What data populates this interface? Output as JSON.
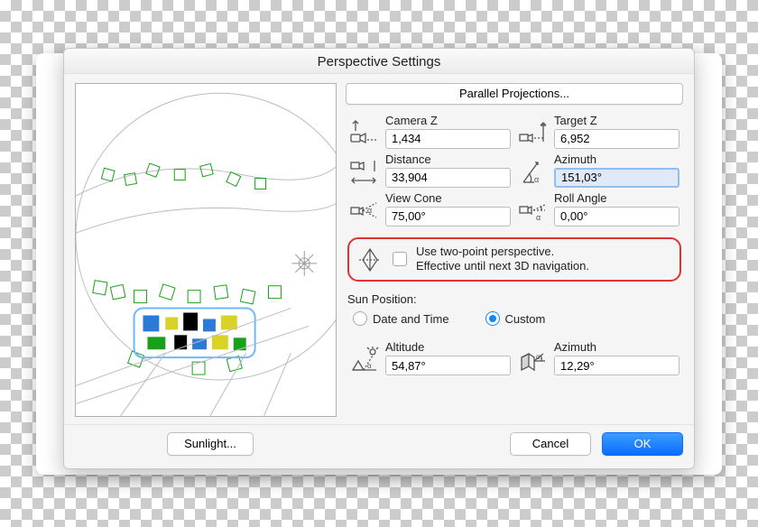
{
  "title": "Perspective Settings",
  "parallel_button": "Parallel Projections...",
  "fields": {
    "camera_z": {
      "label": "Camera Z",
      "value": "1,434"
    },
    "target_z": {
      "label": "Target Z",
      "value": "6,952"
    },
    "distance": {
      "label": "Distance",
      "value": "33,904"
    },
    "azimuth": {
      "label": "Azimuth",
      "value": "151,03°"
    },
    "view_cone": {
      "label": "View Cone",
      "value": "75,00°"
    },
    "roll": {
      "label": "Roll Angle",
      "value": "0,00°"
    }
  },
  "two_point": {
    "checked": false,
    "line1": "Use two-point perspective.",
    "line2": "Effective until next 3D navigation."
  },
  "sun": {
    "title": "Sun Position:",
    "radio_date": "Date and Time",
    "radio_custom": "Custom",
    "selected": "custom",
    "altitude": {
      "label": "Altitude",
      "value": "54,87°"
    },
    "azimuth": {
      "label": "Azimuth",
      "value": "12,29°"
    }
  },
  "buttons": {
    "sunlight": "Sunlight...",
    "cancel": "Cancel",
    "ok": "OK"
  }
}
